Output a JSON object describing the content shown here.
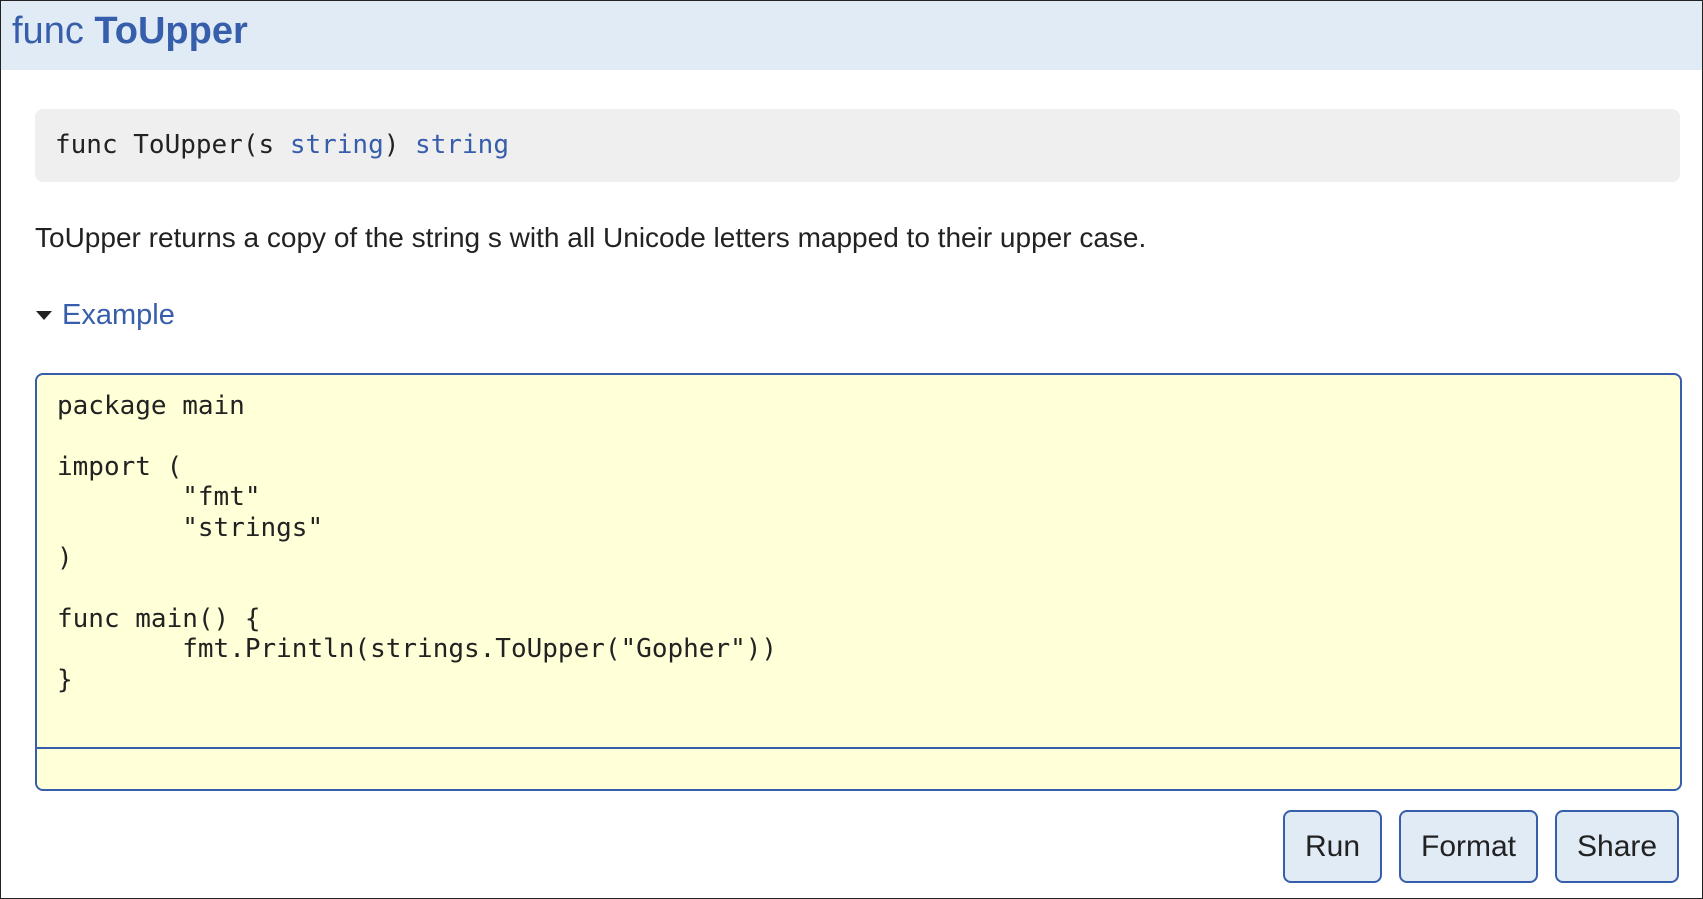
{
  "header": {
    "keyword": "func",
    "name": "ToUpper"
  },
  "signature": {
    "prefix": "func ToUpper(s ",
    "param_type": "string",
    "middle": ") ",
    "return_type": "string"
  },
  "description": "ToUpper returns a copy of the string s with all Unicode letters mapped to their upper case.",
  "example": {
    "label": "Example",
    "code": "package main\n\nimport (\n\t\"fmt\"\n\t\"strings\"\n)\n\nfunc main() {\n\tfmt.Println(strings.ToUpper(\"Gopher\"))\n}\n",
    "output": ""
  },
  "buttons": {
    "run": "Run",
    "format": "Format",
    "share": "Share"
  },
  "colors": {
    "accent": "#375eab",
    "header_bg": "#e0ebf5",
    "code_bg": "#ffffd8",
    "signature_bg": "#efefef"
  }
}
